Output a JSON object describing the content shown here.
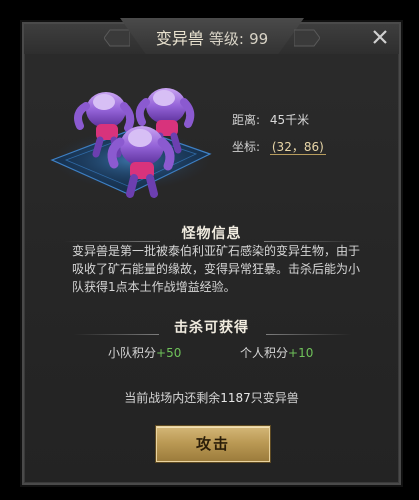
{
  "header": {
    "monster_name": "变异兽",
    "level_label": "等级:",
    "level_value": "99"
  },
  "close_icon": "close-icon",
  "info": {
    "distance_label": "距离:",
    "distance_value": "45千米",
    "coord_label": "坐标:",
    "coord_value": "(32，86)"
  },
  "monster_info": {
    "title": "怪物信息",
    "description": "变异兽是第一批被泰伯利亚矿石感染的变异生物，由于吸收了矿石能量的缘故，变得异常狂暴。击杀后能为小队获得1点本土作战增益经验。"
  },
  "rewards": {
    "title": "击杀可获得",
    "team_label": "小队积分",
    "team_value": "+50",
    "personal_label": "个人积分",
    "personal_value": "+10"
  },
  "remaining": {
    "prefix": "当前战场内还剩余",
    "count": "1187",
    "suffix": "只变异兽"
  },
  "attack_button": "攻击",
  "colors": {
    "accent_gold": "#c7a865",
    "reward_green": "#6fc25a",
    "monster_purple": "#a36be0",
    "monster_pink": "#d8337c"
  }
}
